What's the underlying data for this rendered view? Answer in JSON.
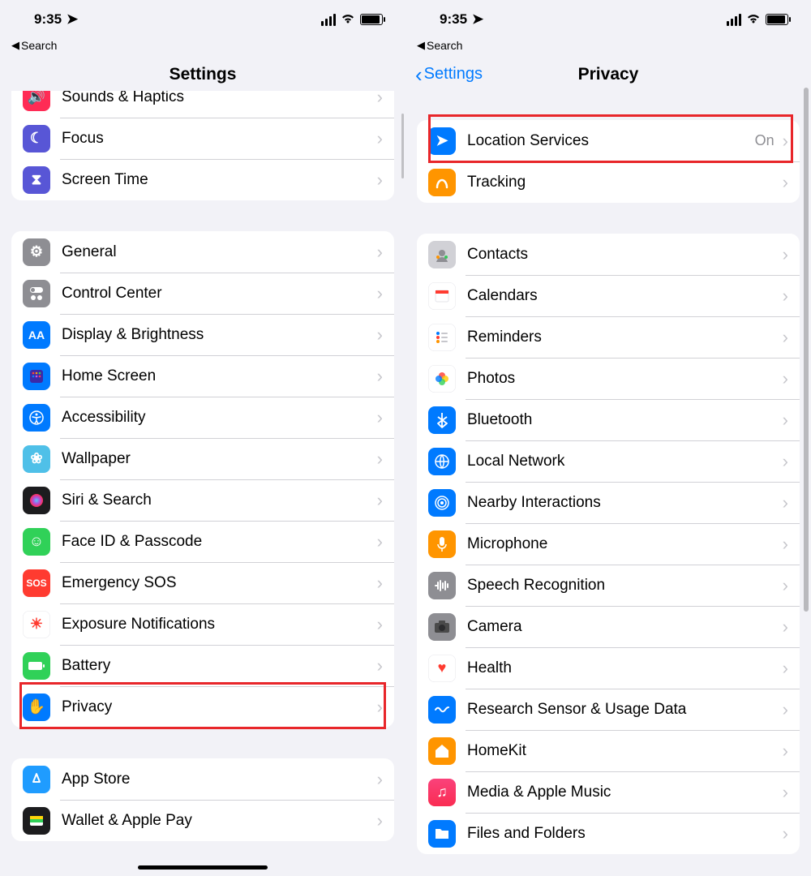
{
  "status": {
    "time": "9:35"
  },
  "breadcrumb": "Search",
  "left": {
    "title": "Settings",
    "group0": [
      {
        "label": "Sounds & Haptics",
        "icon": "🔊",
        "bg": "bg-pink"
      },
      {
        "label": "Focus",
        "icon": "☾",
        "bg": "bg-indigo"
      },
      {
        "label": "Screen Time",
        "icon": "⧗",
        "bg": "bg-indigo"
      }
    ],
    "group1": [
      {
        "label": "General",
        "icon": "⚙",
        "bg": "bg-grey"
      },
      {
        "label": "Control Center",
        "icon": "⌾",
        "bg": "bg-grey"
      },
      {
        "label": "Display & Brightness",
        "icon": "AA",
        "bg": "bg-blue"
      },
      {
        "label": "Home Screen",
        "icon": "▦",
        "bg": "bg-blue"
      },
      {
        "label": "Accessibility",
        "icon": "♿︎",
        "bg": "bg-blue"
      },
      {
        "label": "Wallpaper",
        "icon": "❀",
        "bg": "bg-cyan"
      },
      {
        "label": "Siri & Search",
        "icon": "◉",
        "bg": "bg-dark"
      },
      {
        "label": "Face ID & Passcode",
        "icon": "☺",
        "bg": "bg-green"
      },
      {
        "label": "Emergency SOS",
        "icon": "SOS",
        "bg": "bg-red"
      },
      {
        "label": "Exposure Notifications",
        "icon": "☀",
        "bg": "bg-white"
      },
      {
        "label": "Battery",
        "icon": "▮",
        "bg": "bg-green"
      },
      {
        "label": "Privacy",
        "icon": "✋",
        "bg": "bg-blue"
      }
    ],
    "group2": [
      {
        "label": "App Store",
        "icon": "Ⓐ",
        "bg": "bg-blue"
      },
      {
        "label": "Wallet & Apple Pay",
        "icon": "▭",
        "bg": "bg-dark"
      }
    ]
  },
  "right": {
    "title": "Privacy",
    "back": "Settings",
    "group0": [
      {
        "label": "Location Services",
        "icon": "➤",
        "bg": "bg-blue",
        "detail": "On"
      },
      {
        "label": "Tracking",
        "icon": "↯",
        "bg": "bg-orange"
      }
    ],
    "group1": [
      {
        "label": "Contacts",
        "icon": "◍",
        "bg": "bg-lgrey"
      },
      {
        "label": "Calendars",
        "icon": "▦",
        "bg": "bg-white"
      },
      {
        "label": "Reminders",
        "icon": "⋮",
        "bg": "bg-white"
      },
      {
        "label": "Photos",
        "icon": "✿",
        "bg": "bg-white"
      },
      {
        "label": "Bluetooth",
        "icon": "ᚼ",
        "bg": "bg-blue"
      },
      {
        "label": "Local Network",
        "icon": "⊕",
        "bg": "bg-blue"
      },
      {
        "label": "Nearby Interactions",
        "icon": "◎",
        "bg": "bg-blue"
      },
      {
        "label": "Microphone",
        "icon": "●",
        "bg": "bg-orange"
      },
      {
        "label": "Speech Recognition",
        "icon": "≡",
        "bg": "bg-grey"
      },
      {
        "label": "Camera",
        "icon": "◉",
        "bg": "bg-grey"
      },
      {
        "label": "Health",
        "icon": "♥",
        "bg": "bg-white"
      },
      {
        "label": "Research Sensor & Usage Data",
        "icon": "≋",
        "bg": "bg-blue"
      },
      {
        "label": "HomeKit",
        "icon": "⌂",
        "bg": "bg-orange"
      },
      {
        "label": "Media & Apple Music",
        "icon": "♫",
        "bg": "bg-red"
      },
      {
        "label": "Files and Folders",
        "icon": "▣",
        "bg": "bg-blue"
      }
    ]
  }
}
